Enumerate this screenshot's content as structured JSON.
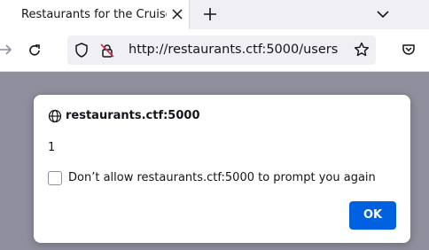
{
  "browser": {
    "tab_title": "Restaurants for the Cruise",
    "url": "http://restaurants.ctf:5000/users"
  },
  "dialog": {
    "origin": "restaurants.ctf:5000",
    "message": "1",
    "checkbox_label": "Don’t allow restaurants.ctf:5000 to prompt you again",
    "ok_label": "OK"
  },
  "colors": {
    "accent": "#0061e0",
    "overlay": "#8f8f9d"
  },
  "icons": [
    "close-icon",
    "plus-icon",
    "chevron-down-icon",
    "back-arrow-icon",
    "reload-icon",
    "shield-icon",
    "insecure-lock-icon",
    "star-icon",
    "pocket-icon",
    "globe-icon"
  ]
}
